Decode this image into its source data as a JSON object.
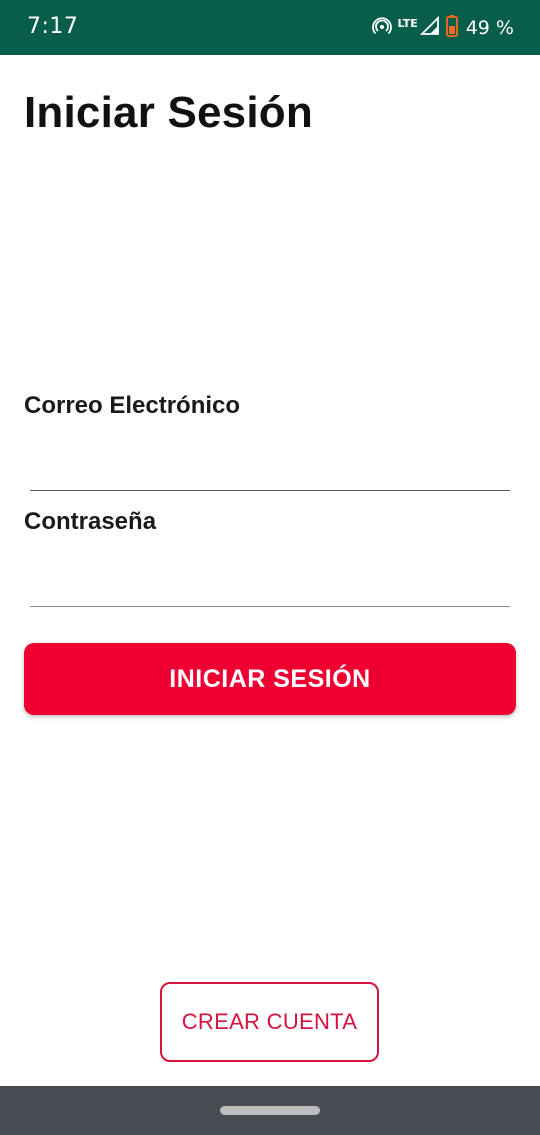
{
  "status_bar": {
    "time": "7:17",
    "network": "LTE",
    "battery": "49 %",
    "icons": [
      "hotspot-icon",
      "signal-icon",
      "battery-icon"
    ]
  },
  "title": "Iniciar Sesión",
  "form": {
    "email_label": "Correo Electrónico",
    "email_value": "",
    "password_label": "Contraseña",
    "password_value": ""
  },
  "buttons": {
    "login": "INICIAR SESIÓN",
    "create_account": "CREAR CUENTA"
  },
  "colors": {
    "status_bar": "#085e4b",
    "primary": "#ee0033",
    "secondary": "#d6123e",
    "nav_bar": "#484c52",
    "battery_icon": "#f26b21"
  }
}
